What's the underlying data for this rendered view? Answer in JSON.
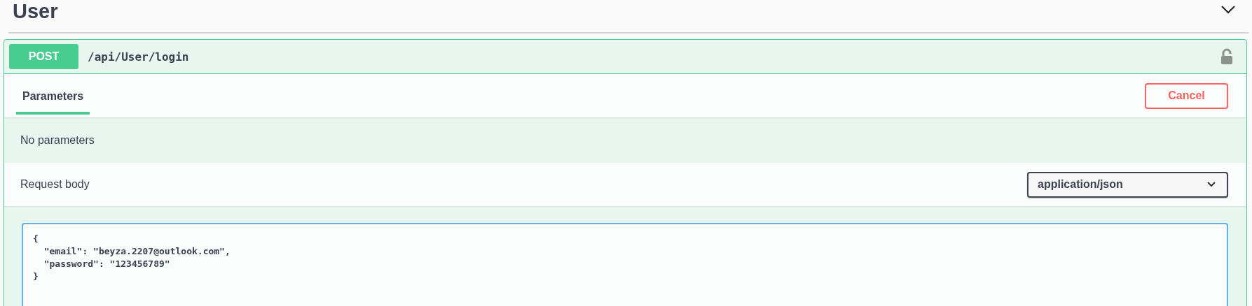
{
  "section": {
    "title": "User",
    "expanded": true
  },
  "operation": {
    "method": "POST",
    "path": "/api/User/login"
  },
  "tabs": [
    {
      "label": "Parameters",
      "selected": true
    }
  ],
  "cancel_button": "Cancel",
  "parameters_message": "No parameters",
  "request_body": {
    "label": "Request body",
    "content_type": "application/json",
    "value": "{\n  \"email\": \"beyza.2207@outlook.com\",\n  \"password\": \"123456789\"\n}"
  }
}
